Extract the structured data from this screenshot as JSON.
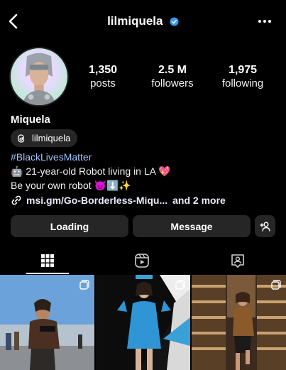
{
  "header": {
    "handle": "lilmiquela",
    "back_icon": "chevron-left-icon",
    "verified_icon": "verified-badge-icon",
    "more_icon": "more-horizontal-icon"
  },
  "profile": {
    "display_name": "Miquela",
    "threads_label": "lilmiquela",
    "stats": [
      {
        "value": "1,350",
        "label": "posts"
      },
      {
        "value": "2.5 M",
        "label": "followers"
      },
      {
        "value": "1,975",
        "label": "following"
      }
    ],
    "bio": {
      "hashtag": "#BlackLivesMatter",
      "line2_emoji_start": "🤖",
      "line2_text": " 21-year-old Robot living in LA ",
      "line2_emoji_end": "💖",
      "line3_text": "Be your own robot ",
      "line3_emojis": "😈⬇️✨"
    },
    "link": {
      "url_text": "msi.gm/Go-Borderless-Miqu...",
      "more_text": "and 2 more"
    }
  },
  "actions": {
    "primary_label": "Loading",
    "message_label": "Message",
    "add_user_icon": "add-user-icon"
  },
  "tabs": [
    {
      "name": "grid",
      "icon": "grid-icon",
      "active": true
    },
    {
      "name": "reels",
      "icon": "reels-icon",
      "active": false
    },
    {
      "name": "tagged",
      "icon": "tagged-icon",
      "active": false
    }
  ],
  "colors": {
    "background": "#000000",
    "button": "#262626",
    "verified": "#3897f0",
    "hashtag": "#a0c4ff"
  },
  "posts": [
    {
      "name": "post-street-outfit",
      "multi": true
    },
    {
      "name": "post-blue-dress",
      "multi": true
    },
    {
      "name": "post-store-aisle",
      "multi": true
    }
  ]
}
